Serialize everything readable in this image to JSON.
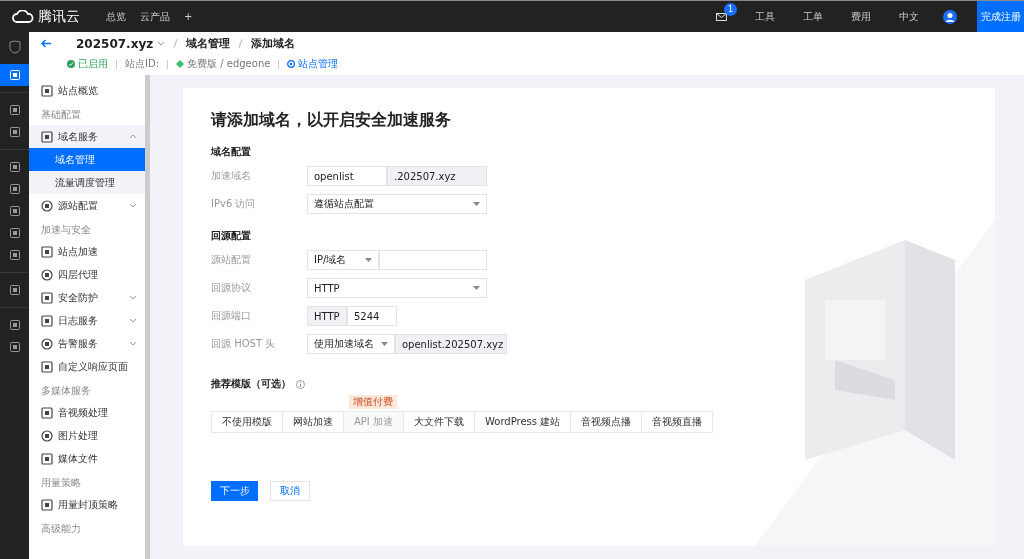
{
  "top_bar": {
    "logo_text": "腾讯云",
    "nav": [
      "总览",
      "云产品",
      "+"
    ],
    "mail_badge": "1",
    "links": [
      "工具",
      "工单",
      "费用",
      "中文"
    ],
    "register_button": "完成注册"
  },
  "header": {
    "site": "202507.xyz",
    "breadcrumbs": [
      "域名管理",
      "添加域名"
    ],
    "status": "已启用",
    "site_id_label": "站点ID:",
    "plan": "免费版 / edgeone",
    "manage_link": "站点管理"
  },
  "rail": [
    {
      "items": [
        {
          "selected": true
        }
      ]
    },
    {
      "items": [
        {
          "selected": false
        },
        {
          "selected": false
        }
      ]
    },
    {
      "items": [
        {
          "selected": false
        },
        {
          "selected": false
        },
        {
          "selected": false
        },
        {
          "selected": false
        },
        {
          "selected": false
        }
      ]
    },
    {
      "items": [
        {
          "selected": false
        }
      ]
    },
    {
      "items": [
        {
          "selected": false
        },
        {
          "selected": false
        }
      ]
    }
  ],
  "sidebar": [
    {
      "items": [
        {
          "label": "站点概览",
          "selected": false
        }
      ]
    },
    {
      "title": "基础配置",
      "items": [
        {
          "label": "域名服务",
          "expanded": true,
          "selected": false,
          "children": [
            {
              "label": "域名管理",
              "selected": true
            },
            {
              "label": "流量调度管理",
              "selected": false
            }
          ]
        },
        {
          "label": "源站配置",
          "expanded": false,
          "selected": false
        }
      ]
    },
    {
      "title": "加速与安全",
      "items": [
        {
          "label": "站点加速",
          "selected": false
        },
        {
          "label": "四层代理",
          "selected": false
        },
        {
          "label": "安全防护",
          "expanded": false,
          "selected": false
        },
        {
          "label": "日志服务",
          "expanded": false,
          "selected": false
        },
        {
          "label": "告警服务",
          "expanded": false,
          "selected": false
        },
        {
          "label": "自定义响应页面",
          "selected": false
        }
      ]
    },
    {
      "title": "多媒体服务",
      "items": [
        {
          "label": "音视频处理",
          "selected": false
        },
        {
          "label": "图片处理",
          "selected": false
        },
        {
          "label": "媒体文件",
          "selected": false
        }
      ]
    },
    {
      "title": "用量策略",
      "items": [
        {
          "label": "用量封顶策略",
          "selected": false
        }
      ]
    },
    {
      "title": "高级能力"
    }
  ],
  "form": {
    "title": "请添加域名，以开启安全加速服务",
    "sections": [
      {
        "title": "域名配置",
        "rows": [
          {
            "kind": "suffix",
            "label": "加速域名",
            "value": "openlist",
            "suffix": ".202507.xyz"
          },
          {
            "kind": "select",
            "label": "IPv6 访问",
            "value": "遵循站点配置"
          }
        ]
      },
      {
        "title": "回源配置",
        "rows": [
          {
            "kind": "select-input",
            "label": "源站配置",
            "select": "IP/域名",
            "value": ""
          },
          {
            "kind": "select",
            "label": "回源协议",
            "value": "HTTP"
          },
          {
            "kind": "prefix",
            "label": "回源端口",
            "prefix": "HTTP",
            "value": "5244"
          },
          {
            "kind": "select-readonly",
            "label": "回源 HOST 头",
            "select": "使用加速域名",
            "value": "openlist.202507.xyz"
          }
        ]
      }
    ],
    "templates_title": "推荐模版（可选）",
    "templates": [
      {
        "label": "不使用模版",
        "selected": false,
        "disabled": false
      },
      {
        "label": "网站加速",
        "selected": false,
        "disabled": false
      },
      {
        "label": "API 加速",
        "selected": false,
        "disabled": true,
        "badge": "增值付费"
      },
      {
        "label": "大文件下载",
        "selected": false,
        "disabled": false
      },
      {
        "label": "WordPress 建站",
        "selected": false,
        "disabled": false
      },
      {
        "label": "音视频点播",
        "selected": false,
        "disabled": false
      },
      {
        "label": "音视频直播",
        "selected": false,
        "disabled": false
      }
    ],
    "next_button": "下一步",
    "cancel_button": "取消"
  }
}
